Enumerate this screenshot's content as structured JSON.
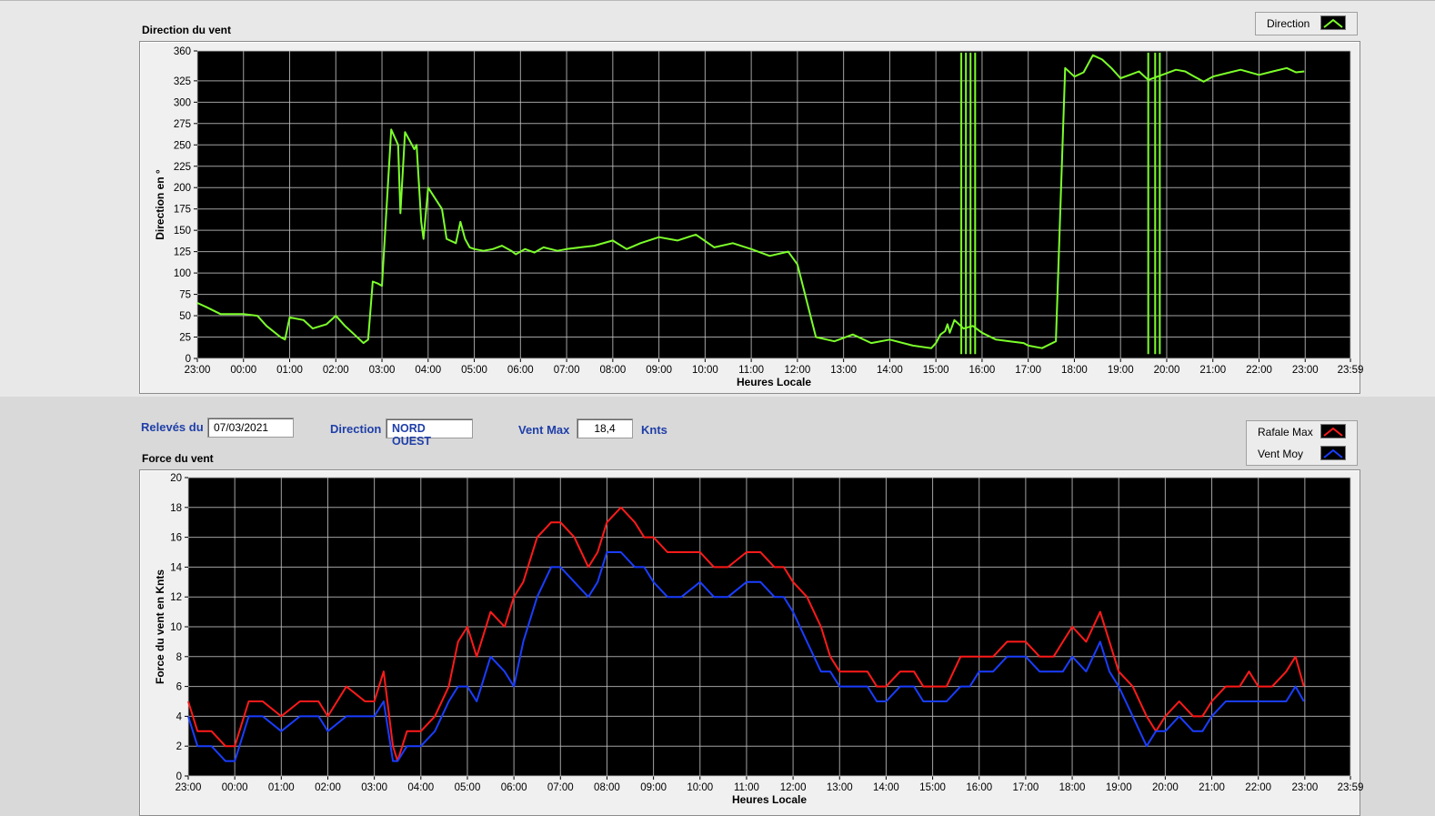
{
  "colors": {
    "direction": "#7cff2a",
    "gust": "#ff1a1a",
    "mean": "#1a3dff",
    "plot_bg": "#000000",
    "grid": "#c0c0c0"
  },
  "direction_chart": {
    "panel_title": "Direction du vent",
    "legend": [
      {
        "label": "Direction",
        "color": "#7cff2a"
      }
    ]
  },
  "controls": {
    "date_label": "Relevés du",
    "date_value": "07/03/2021",
    "direction_label": "Direction",
    "direction_value": "NORD OUEST",
    "vent_max_label": "Vent Max",
    "vent_max_value": "18,4",
    "vent_max_unit": "Knts"
  },
  "force_chart": {
    "panel_title": "Force du vent",
    "legend": [
      {
        "label": "Rafale Max",
        "color": "#ff1a1a"
      },
      {
        "label": "Vent Moy",
        "color": "#1a3dff"
      }
    ]
  },
  "chart_data": [
    {
      "type": "line",
      "ylabel": "Direction en °",
      "xlabel": "Heures Locale",
      "x_ticks": [
        "23:00",
        "00:00",
        "01:00",
        "02:00",
        "03:00",
        "04:00",
        "05:00",
        "06:00",
        "07:00",
        "08:00",
        "09:00",
        "10:00",
        "11:00",
        "12:00",
        "13:00",
        "14:00",
        "15:00",
        "16:00",
        "17:00",
        "18:00",
        "19:00",
        "20:00",
        "21:00",
        "22:00",
        "23:00",
        "23:59"
      ],
      "y_ticks": [
        "0",
        "25",
        "50",
        "75",
        "100",
        "125",
        "150",
        "175",
        "200",
        "225",
        "250",
        "275",
        "300",
        "325",
        "360"
      ],
      "ylim": [
        0,
        360
      ],
      "grid": true,
      "legend_position": "top-right",
      "series": [
        {
          "name": "Direction",
          "color": "#7cff2a",
          "x": [
            0,
            0.2,
            0.5,
            1,
            1.3,
            1.5,
            1.8,
            1.9,
            2,
            2.3,
            2.5,
            2.8,
            3,
            3.2,
            3.4,
            3.6,
            3.7,
            3.8,
            3.9,
            4,
            4.2,
            4.35,
            4.4,
            4.5,
            4.7,
            4.75,
            4.85,
            4.9,
            5,
            5.3,
            5.4,
            5.6,
            5.7,
            5.8,
            5.9,
            6,
            6.2,
            6.4,
            6.6,
            6.8,
            6.9,
            7.1,
            7.3,
            7.5,
            7.8,
            8,
            8.3,
            8.6,
            9,
            9.3,
            9.6,
            10,
            10.4,
            10.8,
            11.2,
            11.6,
            12,
            12.4,
            12.8,
            13,
            13.4,
            13.8,
            14.2,
            14.6,
            15,
            15.5,
            15.9,
            16,
            16.1,
            16.2,
            16.25,
            16.3,
            16.4,
            16.6,
            16.8,
            17,
            17.3,
            17.6,
            17.9,
            18,
            18.3,
            18.6,
            18.8,
            19,
            19.2,
            19.4,
            19.6,
            19.8,
            20,
            20.2,
            20.4,
            20.6,
            20.8,
            21,
            21.2,
            21.4,
            21.6,
            21.8,
            22,
            22.3,
            22.6,
            23,
            23.3,
            23.6,
            23.8,
            23.98
          ],
          "y": [
            65,
            60,
            52,
            52,
            50,
            38,
            25,
            22,
            48,
            45,
            35,
            40,
            50,
            38,
            28,
            18,
            22,
            90,
            88,
            85,
            268,
            250,
            170,
            265,
            245,
            250,
            160,
            140,
            200,
            175,
            140,
            135,
            160,
            140,
            130,
            128,
            126,
            128,
            132,
            126,
            122,
            128,
            124,
            130,
            126,
            128,
            130,
            132,
            138,
            128,
            135,
            142,
            138,
            145,
            130,
            135,
            128,
            120,
            125,
            110,
            25,
            20,
            28,
            18,
            22,
            15,
            12,
            18,
            28,
            32,
            40,
            30,
            45,
            35,
            38,
            30,
            22,
            20,
            18,
            15,
            12,
            20,
            340,
            330,
            335,
            355,
            350,
            340,
            328,
            332,
            336,
            326,
            330,
            334,
            338,
            336,
            330,
            324,
            330,
            334,
            338,
            332,
            336,
            340,
            335,
            336
          ]
        }
      ],
      "spikes": [
        16.55,
        16.65,
        16.75,
        16.85,
        20.6,
        20.75,
        20.85
      ]
    },
    {
      "type": "line",
      "ylabel": "Force du vent en Knts",
      "xlabel": "Heures Locale",
      "x_ticks": [
        "23:00",
        "00:00",
        "01:00",
        "02:00",
        "03:00",
        "04:00",
        "05:00",
        "06:00",
        "07:00",
        "08:00",
        "09:00",
        "10:00",
        "11:00",
        "12:00",
        "13:00",
        "14:00",
        "15:00",
        "16:00",
        "17:00",
        "18:00",
        "19:00",
        "20:00",
        "21:00",
        "22:00",
        "23:00",
        "23:59"
      ],
      "y_ticks": [
        "0",
        "2",
        "4",
        "6",
        "8",
        "10",
        "12",
        "14",
        "16",
        "18",
        "20"
      ],
      "ylim": [
        0,
        20
      ],
      "grid": true,
      "legend_position": "top-right",
      "series": [
        {
          "name": "Rafale Max",
          "color": "#ff1a1a",
          "x": [
            0,
            0.2,
            0.5,
            0.8,
            1,
            1.3,
            1.6,
            2,
            2.4,
            2.8,
            3,
            3.4,
            3.8,
            4,
            4.2,
            4.4,
            4.5,
            4.7,
            5,
            5.3,
            5.6,
            5.8,
            6,
            6.2,
            6.5,
            6.8,
            7,
            7.2,
            7.5,
            7.8,
            8,
            8.3,
            8.6,
            8.8,
            9,
            9.3,
            9.6,
            9.8,
            10,
            10.3,
            10.6,
            11,
            11.3,
            11.6,
            12,
            12.3,
            12.6,
            12.8,
            13,
            13.3,
            13.6,
            13.8,
            14,
            14.3,
            14.6,
            14.8,
            15,
            15.3,
            15.6,
            15.8,
            16,
            16.3,
            16.6,
            16.8,
            17,
            17.3,
            17.6,
            17.8,
            18,
            18.3,
            18.6,
            18.8,
            19,
            19.3,
            19.6,
            19.8,
            20,
            20.3,
            20.6,
            20.8,
            21,
            21.3,
            21.6,
            21.8,
            22,
            22.3,
            22.6,
            22.8,
            23,
            23.3,
            23.6,
            23.8,
            23.98
          ],
          "y": [
            5,
            3,
            3,
            2,
            2,
            5,
            5,
            4,
            5,
            5,
            4,
            6,
            5,
            5,
            7,
            2,
            1,
            3,
            3,
            4,
            6,
            9,
            10,
            8,
            11,
            10,
            12,
            13,
            16,
            17,
            17,
            16,
            14,
            15,
            17,
            18,
            17,
            16,
            16,
            15,
            15,
            15,
            14,
            14,
            15,
            15,
            14,
            14,
            13,
            12,
            10,
            8,
            7,
            7,
            7,
            6,
            6,
            7,
            7,
            6,
            6,
            6,
            8,
            8,
            8,
            8,
            9,
            9,
            9,
            8,
            8,
            9,
            10,
            9,
            11,
            9,
            7,
            6,
            4,
            3,
            4,
            5,
            4,
            4,
            5,
            6,
            6,
            7,
            6,
            6,
            7,
            8,
            6
          ]
        },
        {
          "name": "Vent Moy",
          "color": "#1a3dff",
          "x": [
            0,
            0.2,
            0.5,
            0.8,
            1,
            1.3,
            1.6,
            2,
            2.4,
            2.8,
            3,
            3.4,
            3.8,
            4,
            4.2,
            4.4,
            4.5,
            4.7,
            5,
            5.3,
            5.6,
            5.8,
            6,
            6.2,
            6.5,
            6.8,
            7,
            7.2,
            7.5,
            7.8,
            8,
            8.3,
            8.6,
            8.8,
            9,
            9.3,
            9.6,
            9.8,
            10,
            10.3,
            10.6,
            11,
            11.3,
            11.6,
            12,
            12.3,
            12.6,
            12.8,
            13,
            13.3,
            13.6,
            13.8,
            14,
            14.3,
            14.6,
            14.8,
            15,
            15.3,
            15.6,
            15.8,
            16,
            16.3,
            16.6,
            16.8,
            17,
            17.3,
            17.6,
            17.8,
            18,
            18.3,
            18.6,
            18.8,
            19,
            19.3,
            19.6,
            19.8,
            20,
            20.3,
            20.6,
            20.8,
            21,
            21.3,
            21.6,
            21.8,
            22,
            22.3,
            22.6,
            22.8,
            23,
            23.3,
            23.6,
            23.8,
            23.98
          ],
          "y": [
            4,
            2,
            2,
            1,
            1,
            4,
            4,
            3,
            4,
            4,
            3,
            4,
            4,
            4,
            5,
            1,
            1,
            2,
            2,
            3,
            5,
            6,
            6,
            5,
            8,
            7,
            6,
            9,
            12,
            14,
            14,
            13,
            12,
            13,
            15,
            15,
            14,
            14,
            13,
            12,
            12,
            13,
            12,
            12,
            13,
            13,
            12,
            12,
            11,
            9,
            7,
            7,
            6,
            6,
            6,
            5,
            5,
            6,
            6,
            5,
            5,
            5,
            6,
            6,
            7,
            7,
            8,
            8,
            8,
            7,
            7,
            7,
            8,
            7,
            9,
            7,
            6,
            4,
            2,
            3,
            3,
            4,
            3,
            3,
            4,
            5,
            5,
            5,
            5,
            5,
            5,
            6,
            5
          ]
        }
      ]
    }
  ]
}
